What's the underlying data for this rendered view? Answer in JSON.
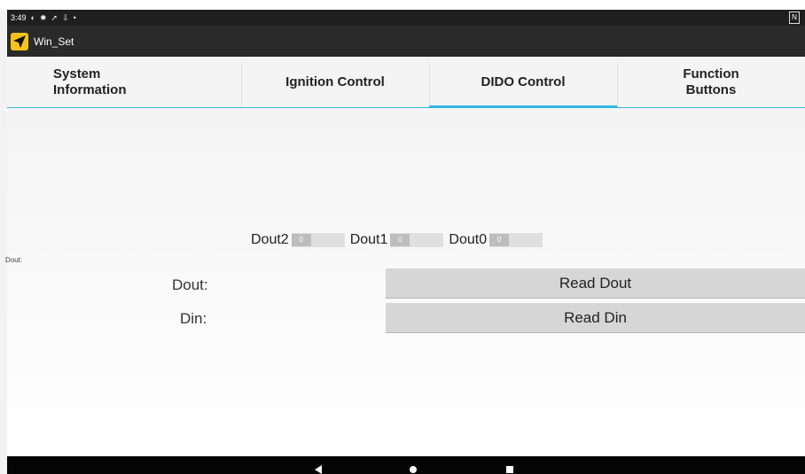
{
  "statusbar": {
    "time": "3:49"
  },
  "app": {
    "title": "Win_Set"
  },
  "tabs": [
    {
      "label_line1": "System",
      "label_line2": "Information"
    },
    {
      "label": "Ignition Control"
    },
    {
      "label": "DIDO Control"
    },
    {
      "label_line1": "Function",
      "label_line2": "Buttons"
    }
  ],
  "dout_switches": [
    {
      "label": "Dout2",
      "state": "0"
    },
    {
      "label": "Dout1",
      "state": "0"
    },
    {
      "label": "Dout0",
      "state": "0"
    }
  ],
  "main": {
    "small_dout_label": "Dout:",
    "dout_label": "Dout:",
    "din_label": "Din:",
    "read_dout_button": "Read Dout",
    "read_din_button": "Read Din"
  },
  "colors": {
    "accent": "#33b5e5",
    "appbar": "#2a2a2a",
    "app_icon": "#f6c21a"
  }
}
